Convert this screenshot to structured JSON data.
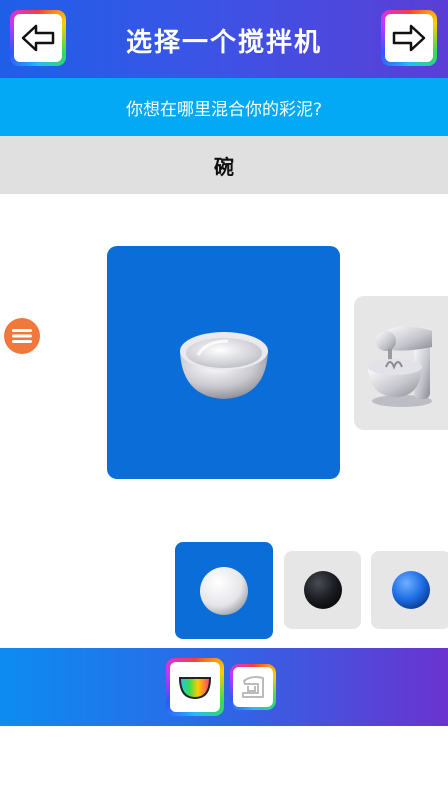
{
  "header": {
    "title": "选择一个搅拌机",
    "back_icon": "arrow-left-icon",
    "next_icon": "arrow-right-icon"
  },
  "subheader": {
    "prompt": "你想在哪里混合你的彩泥?"
  },
  "section": {
    "current_label": "碗"
  },
  "carousel": {
    "selected": "bowl",
    "items": [
      "bowl",
      "stand-mixer"
    ]
  },
  "colors": {
    "options": [
      "#f2f2f2",
      "#1c1e24",
      "#1e6fe6"
    ],
    "selected_index": 0
  },
  "footer": {
    "tabs": [
      "bowl",
      "mixer"
    ],
    "selected_tab": "bowl"
  },
  "theme": {
    "accent": "#0b6ed8",
    "subheader": "#03a9f4",
    "menu": "#f0783c"
  }
}
